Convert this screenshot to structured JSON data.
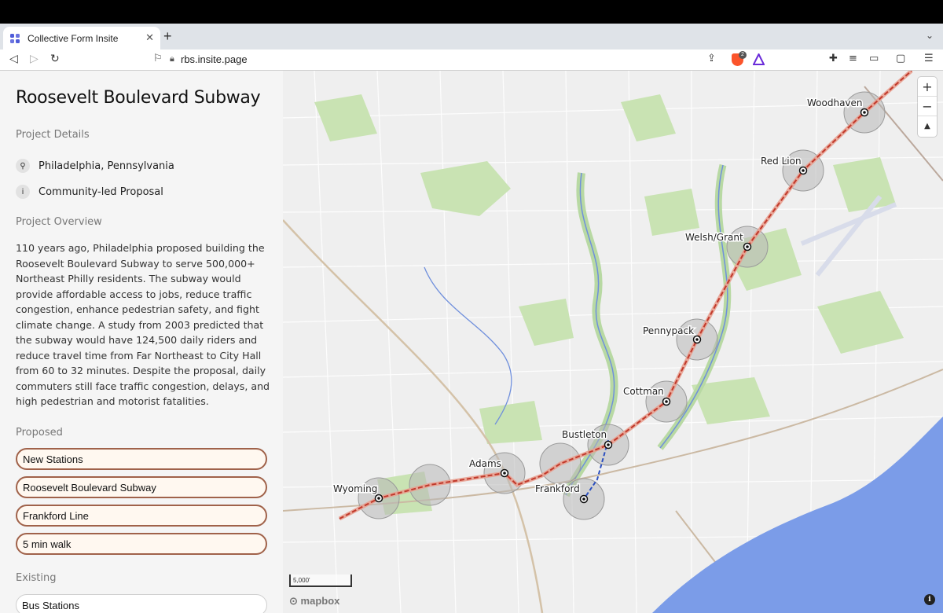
{
  "browser": {
    "tab_title": "Collective Form Insite",
    "url": "rbs.insite.page",
    "shield_count": "2"
  },
  "sidebar": {
    "title": "Roosevelt Boulevard Subway",
    "project_details_label": "Project Details",
    "location": "Philadelphia, Pennsylvania",
    "proposal_type": "Community-led Proposal",
    "overview_label": "Project Overview",
    "overview_text": "110 years ago, Philadelphia proposed building the Roosevelt Boulevard Subway to serve 500,000+ Northeast Philly residents. The subway would provide affordable access to jobs, reduce traffic congestion, enhance pedestrian safety, and fight climate change. A study from 2003 predicted that the subway would have 124,500 daily riders and reduce travel time from Far Northeast to City Hall from 60 to 32 minutes. Despite the proposal, daily commuters still face traffic congestion, delays, and high pedestrian and motorist fatalities.",
    "proposed_label": "Proposed",
    "proposed_layers": [
      "New Stations",
      "Roosevelt Boulevard Subway",
      "Frankford Line",
      "5 min walk"
    ],
    "existing_label": "Existing",
    "existing_layers": [
      "Bus Stations"
    ]
  },
  "map": {
    "stations": [
      {
        "name": "Woodhaven"
      },
      {
        "name": "Red Lion"
      },
      {
        "name": "Welsh/Grant"
      },
      {
        "name": "Pennypack"
      },
      {
        "name": "Cottman"
      },
      {
        "name": "Bustleton"
      },
      {
        "name": "Adams"
      },
      {
        "name": "Frankford"
      },
      {
        "name": "Wyoming"
      }
    ],
    "scale_label": "5,000'",
    "attribution_logo": "mapbox",
    "zoom_in": "+",
    "zoom_out": "−",
    "compass": "▲"
  },
  "colors": {
    "subway_line": "#c0392b",
    "frankford_line": "#2b4fbf",
    "water": "#7b9ce8",
    "park": "#c9e3b3",
    "pill_border": "#a0624a"
  }
}
